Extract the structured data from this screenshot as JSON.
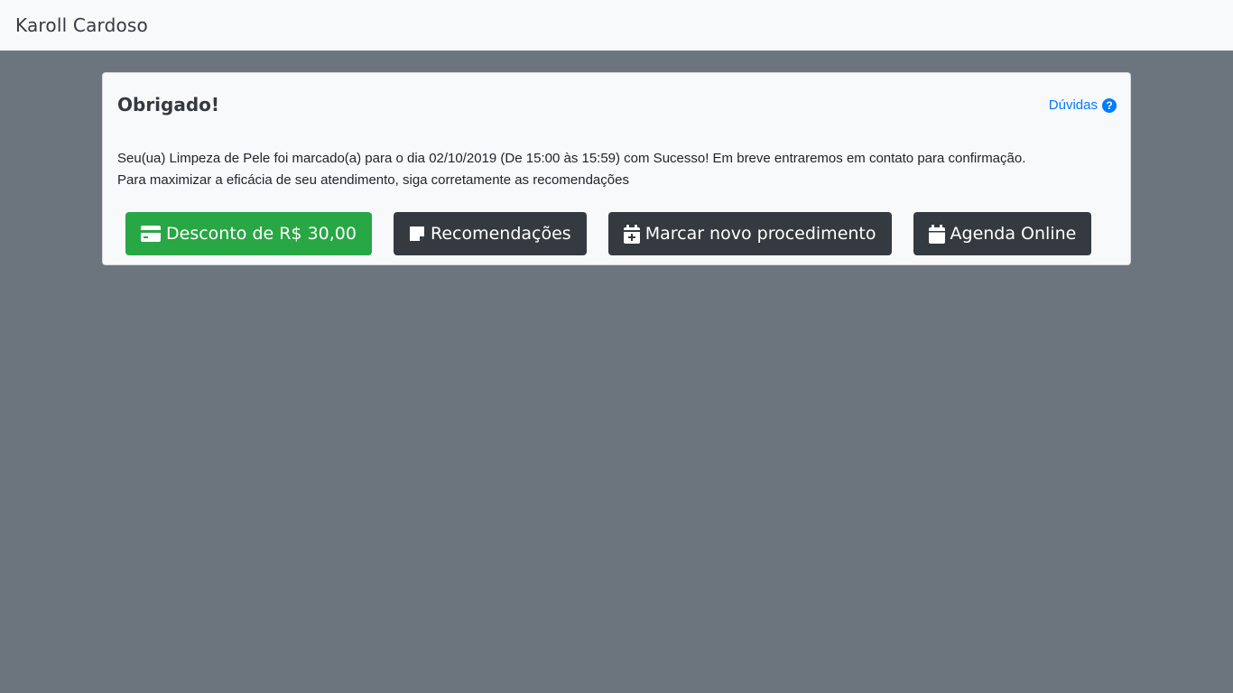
{
  "navbar": {
    "brand": "Karoll Cardoso"
  },
  "card": {
    "title": "Obrigado!",
    "help": {
      "label": "Dúvidas",
      "icon": "question-circle-icon"
    },
    "message_line1": "Seu(ua) Limpeza de Pele foi marcado(a) para o dia 02/10/2019 (De 15:00 às 15:59) com Sucesso! Em breve entraremos em contato para confirmação.",
    "message_line2": "Para maximizar a eficácia de seu atendimento, siga corretamente as recomendações"
  },
  "actions": [
    {
      "label": "Desconto de R$ 30,00",
      "icon": "credit-card-icon",
      "style": "success"
    },
    {
      "label": "Recomendações",
      "icon": "sticky-note-icon",
      "style": "dark"
    },
    {
      "label": "Marcar novo procedimento",
      "icon": "calendar-plus-icon",
      "style": "dark"
    },
    {
      "label": "Agenda Online",
      "icon": "calendar-icon",
      "style": "dark"
    }
  ],
  "colors": {
    "page_bg": "#6c757d",
    "card_bg": "#f8f9fa",
    "success": "#28a745",
    "dark": "#343a40",
    "link": "#007bff"
  }
}
